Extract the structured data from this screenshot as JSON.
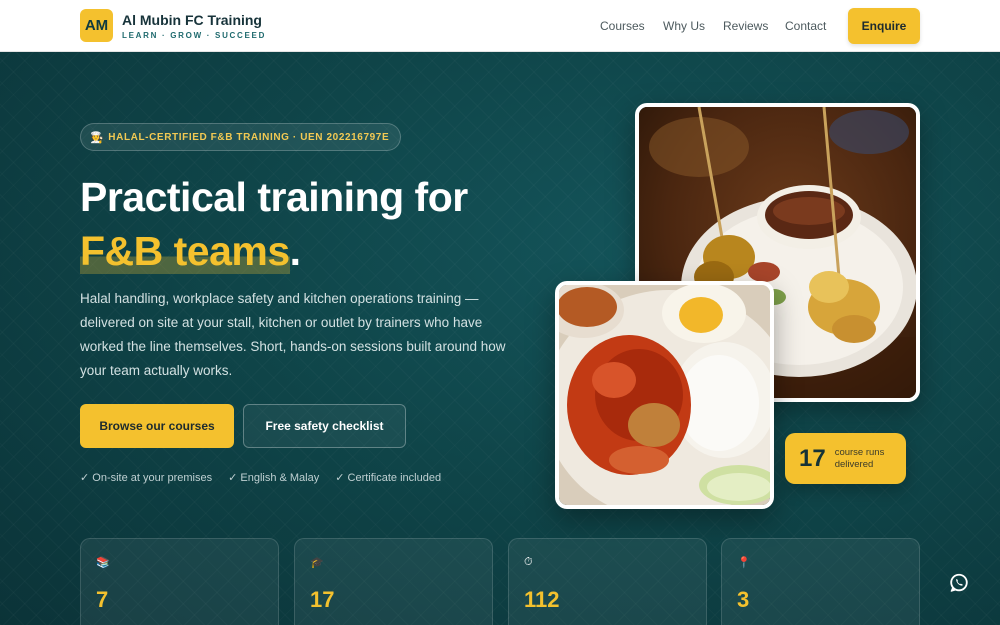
{
  "brand": {
    "initials": "AM",
    "name": "Al Mubin FC Training",
    "tagline": "LEARN · GROW · SUCCEED"
  },
  "nav": {
    "items": [
      "Courses",
      "Why Us",
      "Reviews",
      "Contact"
    ],
    "cta": "Enquire"
  },
  "hero": {
    "pill": {
      "icon": "🧑‍🍳",
      "text": "HALAL-CERTIFIED F&B TRAINING · UEN 202216797E"
    },
    "title_line1": "Practical training for",
    "title_accent": "F&B teams",
    "title_period": ".",
    "lead": "Halal handling, workplace safety and kitchen operations training — delivered on site at your stall, kitchen or outlet by trainers who have worked the line themselves. Short, hands-on sessions built around how your team actually works.",
    "primary_cta": "Browse our courses",
    "secondary_cta": "Free safety checklist",
    "checks": [
      "✓ On-site at your premises",
      "✓ English & Malay",
      "✓ Certificate included"
    ]
  },
  "runs_badge": {
    "value": "17",
    "label": "course runs delivered"
  },
  "stats": [
    {
      "icon": "📚",
      "value": "7"
    },
    {
      "icon": "🎓",
      "value": "17"
    },
    {
      "icon": "⏱",
      "value": "112"
    },
    {
      "icon": "📍",
      "value": "3"
    }
  ],
  "colors": {
    "accent": "#f4c12e",
    "hero_bg": "#0f4549",
    "header_bg": "#ffffff"
  },
  "icons": {
    "whatsapp": "whatsapp-icon"
  }
}
